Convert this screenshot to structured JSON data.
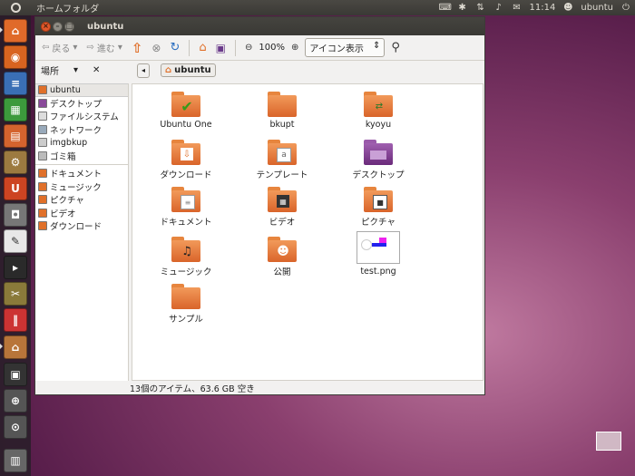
{
  "top_panel": {
    "app_name": "ホームフォルダ",
    "clock": "11:14",
    "user": "ubuntu"
  },
  "window": {
    "title": "ubuntu",
    "toolbar": {
      "back": "戻る",
      "forward": "進む",
      "zoom": "100%",
      "view_mode": "アイコン表示"
    },
    "places_label": "場所",
    "breadcrumb": "ubuntu",
    "sidebar": {
      "group1": [
        "ubuntu",
        "デスクトップ",
        "ファイルシステム",
        "ネットワーク",
        "imgbkup",
        "ゴミ箱"
      ],
      "group2": [
        "ドキュメント",
        "ミュージック",
        "ピクチャ",
        "ビデオ",
        "ダウンロード"
      ]
    },
    "files": [
      {
        "name": "Ubuntu One",
        "icon": "ubuntu-one-folder-icon"
      },
      {
        "name": "bkupt",
        "icon": "folder-icon"
      },
      {
        "name": "kyoyu",
        "icon": "shared-folder-icon"
      },
      {
        "name": "ダウンロード",
        "icon": "download-folder-icon"
      },
      {
        "name": "テンプレート",
        "icon": "templates-folder-icon"
      },
      {
        "name": "デスクトップ",
        "icon": "desktop-folder-icon"
      },
      {
        "name": "ドキュメント",
        "icon": "documents-folder-icon"
      },
      {
        "name": "ビデオ",
        "icon": "videos-folder-icon"
      },
      {
        "name": "ピクチャ",
        "icon": "pictures-folder-icon"
      },
      {
        "name": "ミュージック",
        "icon": "music-folder-icon"
      },
      {
        "name": "公開",
        "icon": "public-folder-icon"
      },
      {
        "name": "test.png",
        "icon": "image-thumbnail-icon"
      },
      {
        "name": "サンプル",
        "icon": "folder-icon"
      }
    ],
    "status": "13個のアイテム、63.6 GB 空き"
  },
  "colors": {
    "folder": "#e2702f",
    "desktop_folder": "#7b3d8c",
    "window_bg": "#f2f1f0",
    "panel": "#3c3b37"
  }
}
